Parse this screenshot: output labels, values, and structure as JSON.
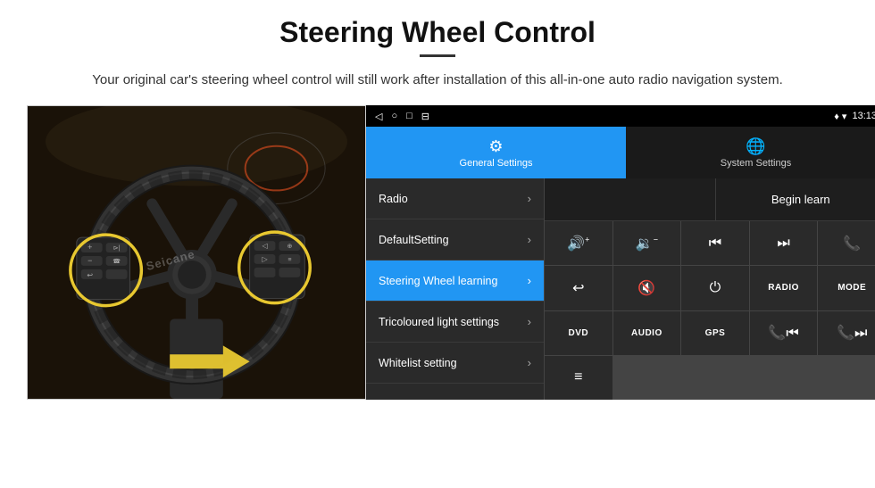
{
  "page": {
    "title": "Steering Wheel Control",
    "subtitle": "Your original car's steering wheel control will still work after installation of this all-in-one auto radio navigation system.",
    "divider": "—"
  },
  "android": {
    "status_bar": {
      "nav_back": "◁",
      "nav_home": "○",
      "nav_recent": "□",
      "nav_more": "⊟",
      "gps_icon": "♦",
      "wifi_icon": "▾",
      "time": "13:13"
    },
    "tabs": [
      {
        "label": "General Settings",
        "active": true
      },
      {
        "label": "System Settings",
        "active": false
      }
    ],
    "menu_items": [
      {
        "label": "Radio",
        "active": false
      },
      {
        "label": "DefaultSetting",
        "active": false
      },
      {
        "label": "Steering Wheel learning",
        "active": true
      },
      {
        "label": "Tricoloured light settings",
        "active": false
      },
      {
        "label": "Whitelist setting",
        "active": false
      }
    ],
    "begin_learn": "Begin learn",
    "control_buttons": [
      {
        "type": "icon",
        "label": "vol-up",
        "icon": "🔊+"
      },
      {
        "type": "icon",
        "label": "vol-down",
        "icon": "🔉−"
      },
      {
        "type": "icon",
        "label": "prev-track",
        "icon": "⏮"
      },
      {
        "type": "icon",
        "label": "next-track",
        "icon": "⏭"
      },
      {
        "type": "icon",
        "label": "phone",
        "icon": "📞"
      },
      {
        "type": "icon",
        "label": "hang-up",
        "icon": "↩"
      },
      {
        "type": "icon",
        "label": "mute",
        "icon": "🔇"
      },
      {
        "type": "icon",
        "label": "power",
        "icon": "⏻"
      },
      {
        "type": "text",
        "label": "RADIO",
        "icon": "RADIO"
      },
      {
        "type": "text",
        "label": "MODE",
        "icon": "MODE"
      },
      {
        "type": "text",
        "label": "DVD",
        "icon": "DVD"
      },
      {
        "type": "text",
        "label": "AUDIO",
        "icon": "AUDIO"
      },
      {
        "type": "text",
        "label": "GPS",
        "icon": "GPS"
      },
      {
        "type": "icon",
        "label": "phone-prev",
        "icon": "📞⏮"
      },
      {
        "type": "icon",
        "label": "phone-next",
        "icon": "📞⏭"
      },
      {
        "type": "icon",
        "label": "list-icon",
        "icon": "≡"
      }
    ]
  },
  "watermark": "Seicane"
}
